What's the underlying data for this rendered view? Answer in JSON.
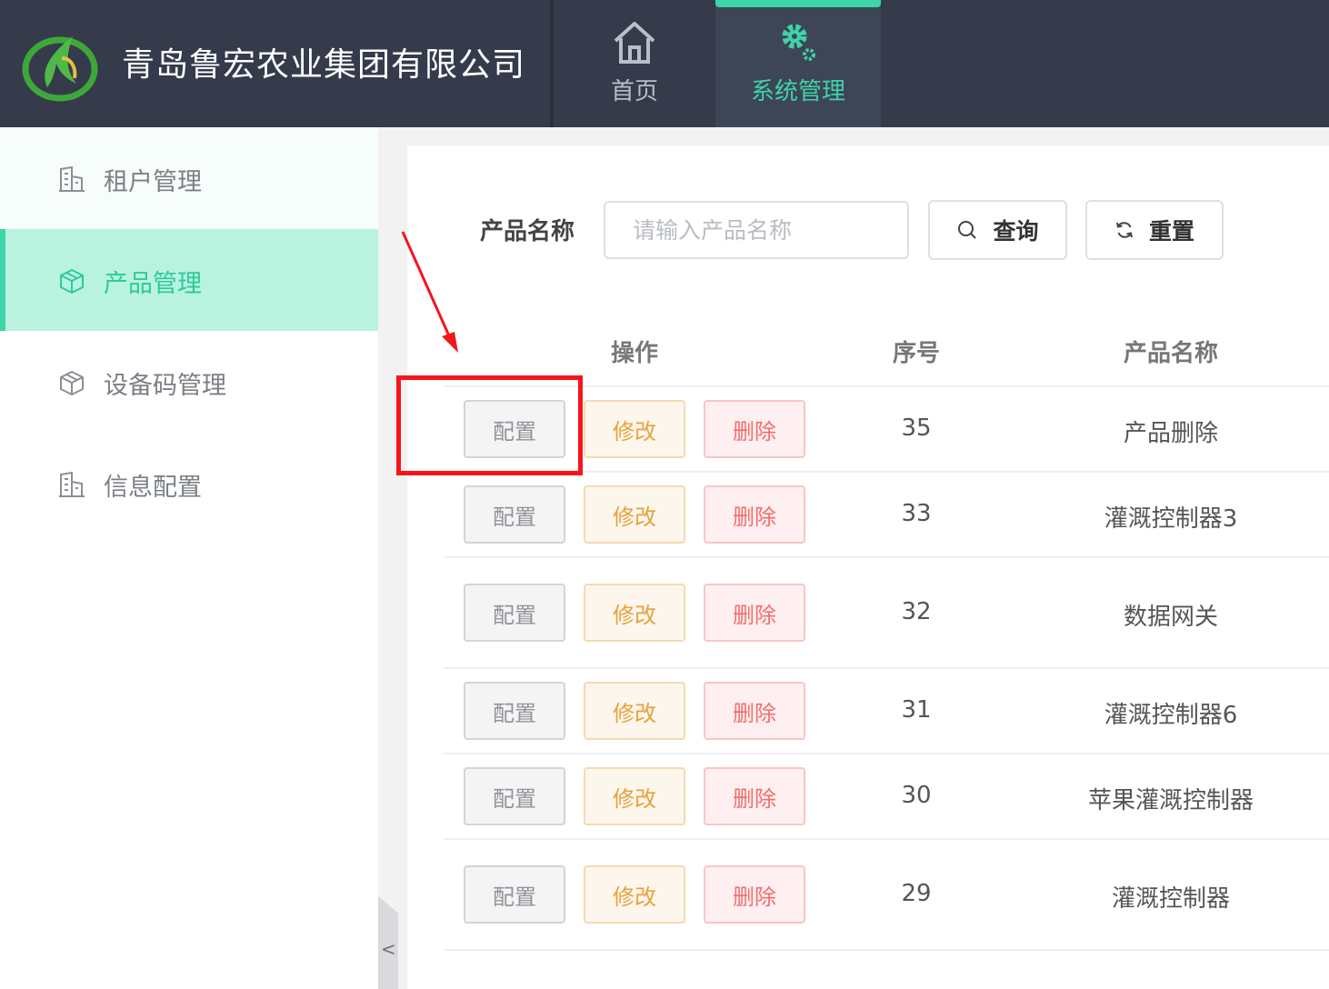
{
  "header": {
    "company": "青岛鲁宏农业集团有限公司",
    "nav": [
      {
        "label": "首页",
        "icon": "home-icon"
      },
      {
        "label": "系统管理",
        "icon": "gear-icon",
        "active": true
      }
    ]
  },
  "sidebar": {
    "items": [
      {
        "label": "租户管理",
        "icon": "building-icon"
      },
      {
        "label": "产品管理",
        "icon": "cube-icon",
        "active": true
      },
      {
        "label": "设备码管理",
        "icon": "cube-icon"
      },
      {
        "label": "信息配置",
        "icon": "building-icon"
      }
    ],
    "collapse_label": "<"
  },
  "search": {
    "label": "产品名称",
    "placeholder": "请输入产品名称",
    "value": "",
    "query_label": "查询",
    "reset_label": "重置"
  },
  "table": {
    "headers": {
      "op": "操作",
      "no": "序号",
      "name": "产品名称"
    },
    "actions": {
      "config": "配置",
      "edit": "修改",
      "delete": "删除"
    },
    "rows": [
      {
        "no": "35",
        "name": "产品删除"
      },
      {
        "no": "33",
        "name": "灌溉控制器3"
      },
      {
        "no": "32",
        "name": "数据网关"
      },
      {
        "no": "31",
        "name": "灌溉控制器6"
      },
      {
        "no": "30",
        "name": "苹果灌溉控制器"
      },
      {
        "no": "29",
        "name": "灌溉控制器"
      }
    ]
  },
  "colors": {
    "header_bg": "#353b4b",
    "accent": "#3fd3a8",
    "active_side_bg": "#b9f3e0",
    "highlight": "#f5161b",
    "edit": "#e6a23c",
    "delete": "#f56c6c"
  }
}
